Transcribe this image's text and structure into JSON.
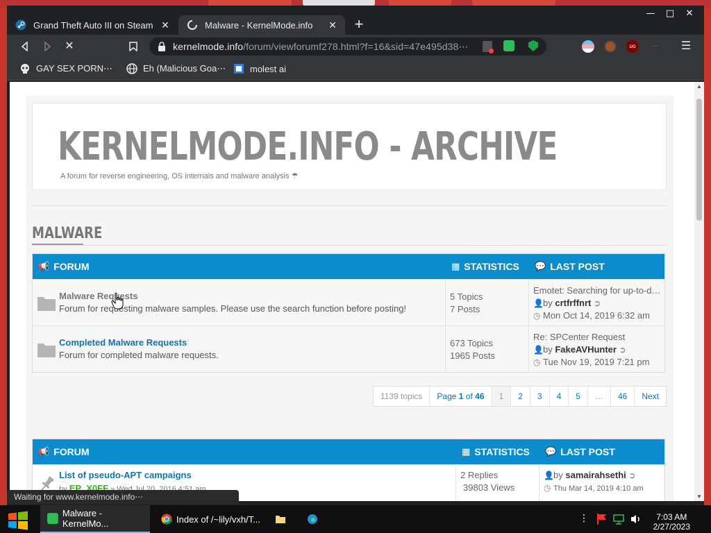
{
  "browser": {
    "tabs": [
      {
        "title": "Grand Theft Auto III on Steam",
        "active": false
      },
      {
        "title": "Malware - KernelMode.info",
        "active": true
      }
    ],
    "url_host": "kernelmode.info",
    "url_path": "/forum/viewforumf278.html?f=16&sid=47e495d38⋯",
    "bookmarks": [
      {
        "label": "GAY SEX PORN⋯"
      },
      {
        "label": "Eh (Malicious Goa⋯"
      },
      {
        "label": "molest ai"
      }
    ],
    "status_text": "Waiting for www.kernelmode.info⋯"
  },
  "site": {
    "title": "KERNELMODE.INFO - ARCHIVE",
    "description": "A forum for reverse engineering, OS internals and malware analysis",
    "section": "MALWARE"
  },
  "subforums": {
    "header": {
      "forum": "FORUM",
      "statistics": "STATISTICS",
      "last_post": "LAST POST"
    },
    "rows": [
      {
        "title": "Malware Requests",
        "description": "Forum for requesting malware samples. Please use the search function before posting!",
        "topics": "5 Topics",
        "posts": "7 Posts",
        "last_title": "Emotet: Searching for up-to-d…",
        "by": "by",
        "last_user": "crtfrffnrt",
        "last_date": "Mon Oct 14, 2019 6:32 am"
      },
      {
        "title": "Completed Malware Requests",
        "description": "Forum for completed malware requests.",
        "topics": "673 Topics",
        "posts": "1965 Posts",
        "last_title": "Re: SPCenter Request",
        "by": "by",
        "last_user": "FakeAVHunter",
        "last_date": "Tue Nov 19, 2019 7:21 pm"
      }
    ]
  },
  "pagination": {
    "total": "1139 topics",
    "page_prefix": "Page",
    "page_current": "1",
    "page_of": "of",
    "page_total": "46",
    "pages": [
      "1",
      "2",
      "3",
      "4",
      "5",
      "…",
      "46"
    ],
    "next": "Next"
  },
  "topics": {
    "header": {
      "forum": "FORUM",
      "statistics": "STATISTICS",
      "last_post": "LAST POST"
    },
    "rows": [
      {
        "title": "List of pseudo-APT campaigns",
        "by": "by",
        "poster": "EP_X0FF",
        "date": "» Wed Jul 20, 2016 4:51 am",
        "replies": "2 Replies",
        "views": "39803 Views",
        "last_by": "by",
        "last_user": "samairahsethi",
        "last_date": "Thu Mar 14, 2019 4:10 am"
      }
    ]
  },
  "taskbar": {
    "items": [
      {
        "label": "Malware - KernelMo..."
      },
      {
        "label": "Index of /~lily/vxh/T..."
      }
    ],
    "time": "7:03 AM",
    "date": "2/27/2023"
  },
  "colors": {
    "accent": "#0c8ccd",
    "link": "#0c73b8",
    "poster": "#28c200"
  }
}
